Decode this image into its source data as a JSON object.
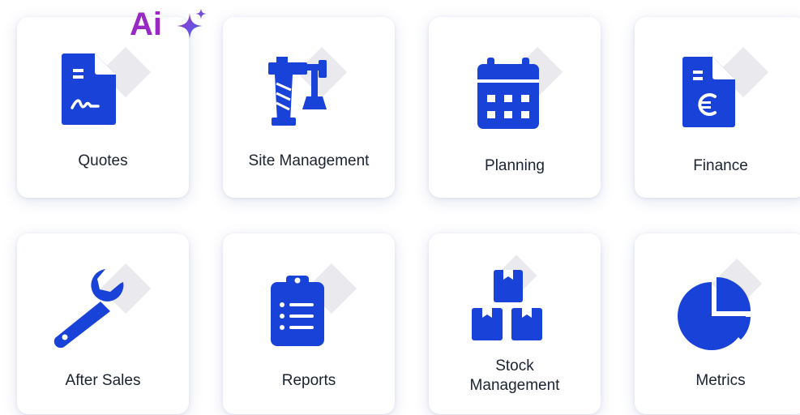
{
  "ai_badge": {
    "text": "Ai",
    "icon": "sparkle-icon",
    "color": "#9a28c2"
  },
  "modules": [
    {
      "label": "Quotes",
      "icon": "quote-document-icon"
    },
    {
      "label": "Site Management",
      "icon": "crane-tools-icon"
    },
    {
      "label": "Planning",
      "icon": "calendar-icon"
    },
    {
      "label": "Finance",
      "icon": "euro-document-icon"
    },
    {
      "label": "After Sales",
      "icon": "wrench-icon"
    },
    {
      "label": "Reports",
      "icon": "clipboard-list-icon"
    },
    {
      "label": "Stock Management",
      "label_lines": [
        "Stock",
        "Management"
      ],
      "icon": "stacked-boxes-icon"
    },
    {
      "label": "Metrics",
      "icon": "pie-chart-icon"
    }
  ],
  "colors": {
    "icon_blue": "#1942d8",
    "shadow_diamond": "#e9e9ee",
    "text": "#1b2230"
  }
}
